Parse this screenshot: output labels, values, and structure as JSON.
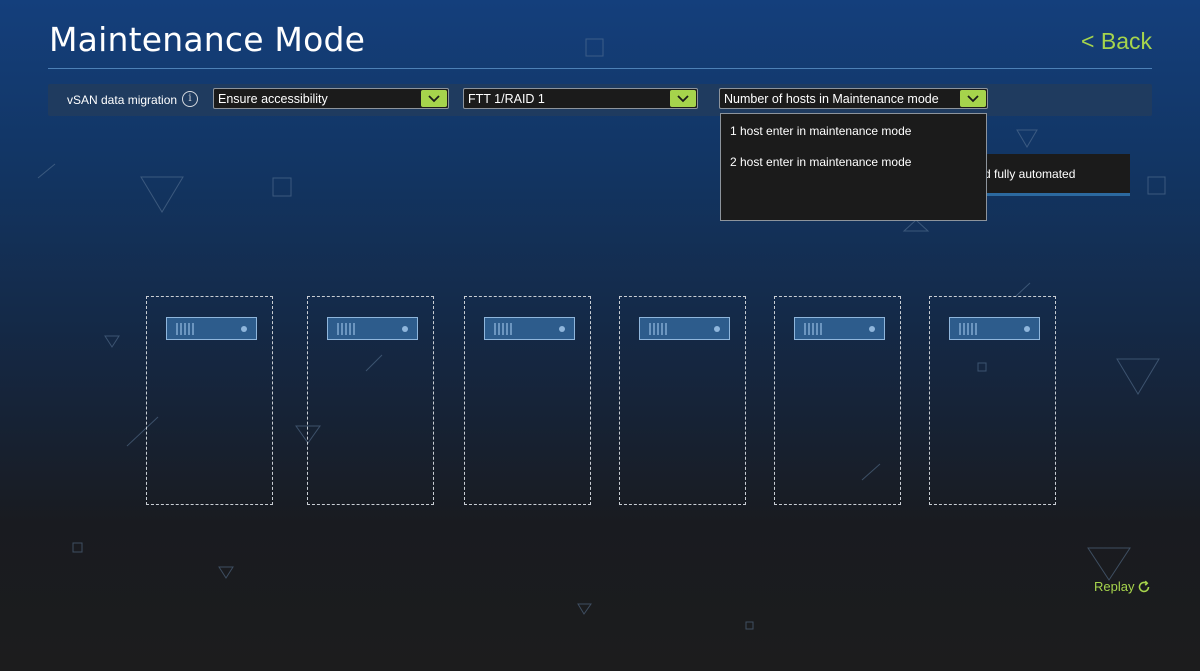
{
  "header": {
    "title": "Maintenance Mode",
    "back_label": "< Back"
  },
  "filters": {
    "label": "vSAN data migration",
    "info_icon": "i",
    "selects": [
      {
        "value": "Ensure accessibility"
      },
      {
        "value": "FTT 1/RAID 1"
      },
      {
        "value": "Number of hosts in Maintenance mode"
      }
    ]
  },
  "dropdown": {
    "options": [
      "1 host enter in maintenance mode",
      "2 host enter in maintenance mode"
    ]
  },
  "side_panel": {
    "text": "d fully automated"
  },
  "footer": {
    "replay_label": "Replay"
  },
  "colors": {
    "accent": "#a6d44c",
    "server_fill": "#2d5c8c",
    "bar_background": "#1f3b5f"
  },
  "icons": {
    "info": "info-icon",
    "chevron": "chevron-down-icon",
    "replay": "replay-icon",
    "server": "server-icon"
  }
}
